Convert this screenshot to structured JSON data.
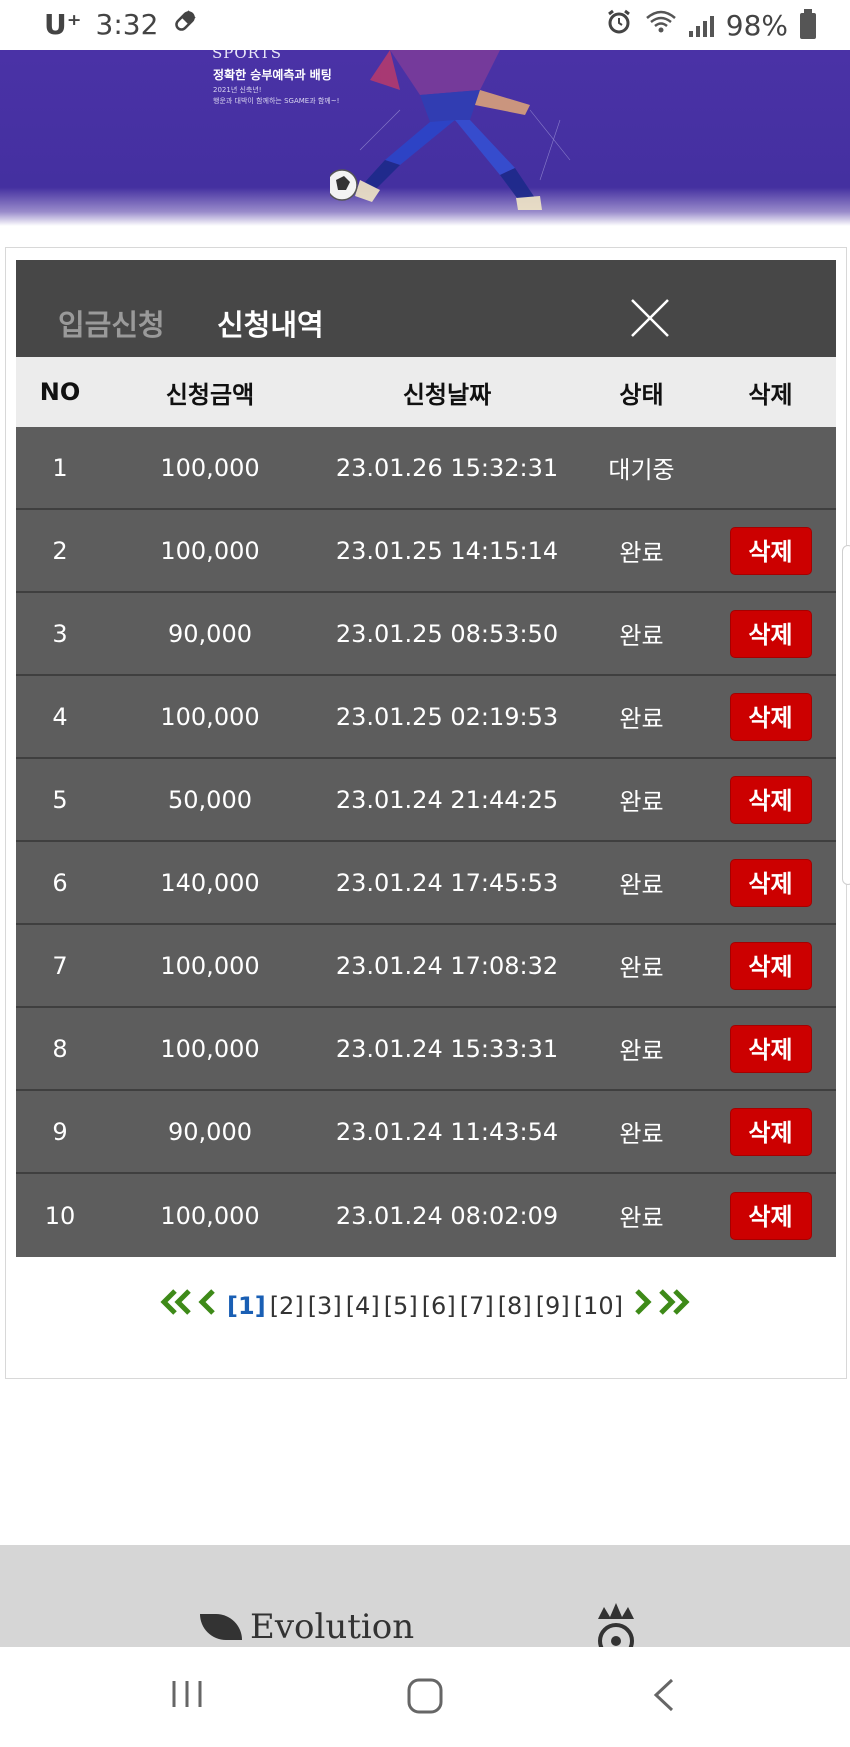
{
  "status_bar": {
    "carrier": "U⁺",
    "time": "3:32",
    "battery": "98%"
  },
  "banner": {
    "brand": "SPORTS",
    "headline": "정확한 승부예측과 배팅",
    "sub_line1": "2021년 신축년!",
    "sub_line2": "행운과 대박이 함께하는 SGAME과 함께~!"
  },
  "modal": {
    "tabs": [
      {
        "label": "입금신청",
        "active": false
      },
      {
        "label": "신청내역",
        "active": true
      }
    ],
    "columns": [
      "NO",
      "신청금액",
      "신청날짜",
      "상태",
      "삭제"
    ],
    "rows": [
      {
        "no": "1",
        "amount": "100,000",
        "date": "23.01.26 15:32:31",
        "status": "대기중",
        "delete": ""
      },
      {
        "no": "2",
        "amount": "100,000",
        "date": "23.01.25 14:15:14",
        "status": "완료",
        "delete": "삭제"
      },
      {
        "no": "3",
        "amount": "90,000",
        "date": "23.01.25 08:53:50",
        "status": "완료",
        "delete": "삭제"
      },
      {
        "no": "4",
        "amount": "100,000",
        "date": "23.01.25 02:19:53",
        "status": "완료",
        "delete": "삭제"
      },
      {
        "no": "5",
        "amount": "50,000",
        "date": "23.01.24 21:44:25",
        "status": "완료",
        "delete": "삭제"
      },
      {
        "no": "6",
        "amount": "140,000",
        "date": "23.01.24 17:45:53",
        "status": "완료",
        "delete": "삭제"
      },
      {
        "no": "7",
        "amount": "100,000",
        "date": "23.01.24 17:08:32",
        "status": "완료",
        "delete": "삭제"
      },
      {
        "no": "8",
        "amount": "100,000",
        "date": "23.01.24 15:33:31",
        "status": "완료",
        "delete": "삭제"
      },
      {
        "no": "9",
        "amount": "90,000",
        "date": "23.01.24 11:43:54",
        "status": "완료",
        "delete": "삭제"
      },
      {
        "no": "10",
        "amount": "100,000",
        "date": "23.01.24 08:02:09",
        "status": "완료",
        "delete": "삭제"
      }
    ]
  },
  "pagination": {
    "first": "«",
    "prev": "‹",
    "pages": [
      "[1]",
      "[2]",
      "[3]",
      "[4]",
      "[5]",
      "[6]",
      "[7]",
      "[8]",
      "[9]",
      "[10]"
    ],
    "current": "[1]",
    "next": "›",
    "last": "»"
  },
  "footer": {
    "logo_text": "Evolution"
  },
  "colors": {
    "banner": "#4430a0",
    "panel_header": "#474747",
    "row_bg": "#5d5d5d",
    "delete_btn": "#cc0000",
    "pager_arrow": "#3e8a18",
    "pager_current": "#1a5fb4"
  }
}
